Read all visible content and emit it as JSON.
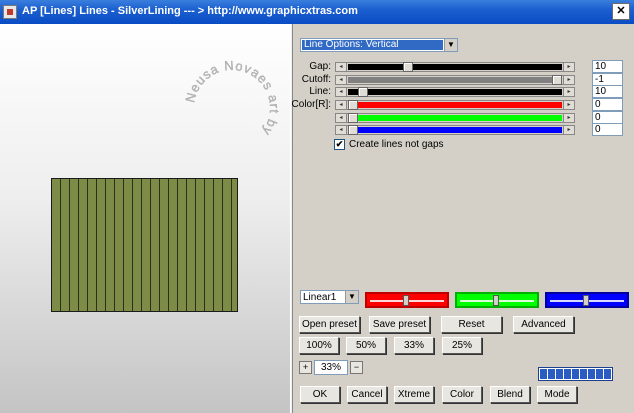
{
  "window": {
    "title": "AP [Lines]  Lines - SilverLining     --- > http://www.graphicxtras.com",
    "close_label": "✕"
  },
  "preview": {
    "watermark_text": "Neusa Novaes     art by",
    "pattern_color": "#7c8c46"
  },
  "controls": {
    "line_options": "Line Options: Vertical",
    "rows": [
      {
        "label": "Gap:",
        "value": "10",
        "track_color": "#000000",
        "position": 0.27
      },
      {
        "label": "Cutoff:",
        "value": "-1",
        "track_color": "#808080",
        "position": 1.0
      },
      {
        "label": "Line:",
        "value": "10",
        "track_color": "#000000",
        "position": 0.05
      },
      {
        "label": "Color[R]:",
        "value": "0",
        "track_color": "#ff0000",
        "position": 0.0
      },
      {
        "label": "",
        "value": "0",
        "track_color": "#00ff00",
        "position": 0.0
      },
      {
        "label": "",
        "value": "0",
        "track_color": "#0000ff",
        "position": 0.0
      }
    ],
    "create_lines_checked": "✔",
    "create_lines_label": "Create lines not gaps",
    "preset_select": "Linear1",
    "color_bars": [
      {
        "name": "red",
        "color": "#ff0000",
        "border": "#c00000",
        "position": 0.5
      },
      {
        "name": "green",
        "color": "#00ff00",
        "border": "#00b000",
        "position": 0.5
      },
      {
        "name": "blue",
        "color": "#0000ff",
        "border": "#0000a0",
        "position": 0.5
      }
    ],
    "preset_buttons": {
      "open": "Open preset",
      "save": "Save preset",
      "reset": "Reset",
      "advanced": "Advanced"
    },
    "zoom_buttons": [
      "100%",
      "50%",
      "33%",
      "25%"
    ],
    "zoom": {
      "plus": "+",
      "value": "33%",
      "minus": "−"
    },
    "bottom_buttons": [
      "OK",
      "Cancel",
      "Xtreme",
      "Color",
      "Blend",
      "Mode"
    ]
  }
}
